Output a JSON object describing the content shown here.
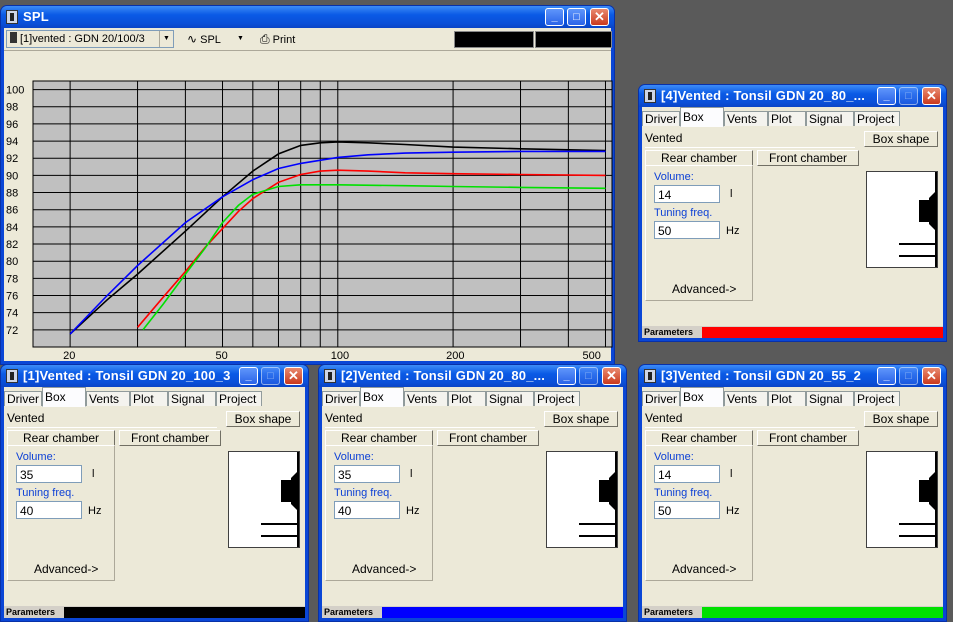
{
  "spl": {
    "title": "SPL",
    "combo_label": "[1]vented : GDN 20/100/3",
    "mode_label": "SPL",
    "print_label": "Print",
    "icons": {
      "window": "speaker-icon",
      "wave": "sine-wave-icon",
      "print": "printer-icon"
    },
    "y_ticks": [
      "100",
      "98",
      "96",
      "94",
      "92",
      "90",
      "88",
      "86",
      "84",
      "82",
      "80",
      "78",
      "76",
      "74",
      "72"
    ],
    "x_ticks": [
      "20",
      "50",
      "100",
      "200",
      "500"
    ]
  },
  "chart_data": {
    "type": "line",
    "xscale": "log",
    "xlim": [
      16,
      520
    ],
    "ylim": [
      70,
      101
    ],
    "grid": true,
    "x_ticks": [
      20,
      50,
      100,
      200,
      500
    ],
    "y_ticks": [
      72,
      74,
      76,
      78,
      80,
      82,
      84,
      86,
      88,
      90,
      92,
      94,
      96,
      98,
      100
    ],
    "series": [
      {
        "color": "#000000",
        "x": [
          20,
          25,
          30,
          40,
          50,
          60,
          70,
          80,
          90,
          100,
          120,
          150,
          200,
          300,
          500
        ],
        "y": [
          71.5,
          75.5,
          78.5,
          83.5,
          87.5,
          90.5,
          92.5,
          93.5,
          93.8,
          93.9,
          93.8,
          93.6,
          93.3,
          93.1,
          92.9
        ]
      },
      {
        "color": "#0000ff",
        "x": [
          20,
          25,
          30,
          40,
          50,
          60,
          70,
          80,
          100,
          120,
          150,
          200,
          300,
          500
        ],
        "y": [
          71.5,
          76,
          79.5,
          84.5,
          87.5,
          89.5,
          90.8,
          91.4,
          92.1,
          92.4,
          92.6,
          92.7,
          92.8,
          92.8
        ]
      },
      {
        "color": "#ff0000",
        "x": [
          30,
          35,
          40,
          45,
          50,
          55,
          60,
          70,
          80,
          90,
          100,
          120,
          150,
          200,
          300,
          500
        ],
        "y": [
          72.3,
          75.8,
          78.8,
          81.6,
          83.8,
          85.8,
          87.3,
          89.2,
          90.1,
          90.5,
          90.6,
          90.5,
          90.3,
          90.2,
          90.1,
          90.0
        ]
      },
      {
        "color": "#00e000",
        "x": [
          31,
          35,
          40,
          45,
          50,
          55,
          60,
          70,
          80,
          100,
          150,
          200,
          300,
          500
        ],
        "y": [
          72,
          75,
          78.5,
          81.5,
          84.5,
          86.5,
          87.8,
          88.7,
          88.9,
          88.9,
          88.8,
          88.7,
          88.6,
          88.5
        ]
      }
    ]
  },
  "windows": [
    {
      "title": "[4]Vented : Tonsil GDN 20_80_...",
      "tabs": [
        "Driver",
        "Box",
        "Vents",
        "Plot",
        "Signal",
        "Project"
      ],
      "active_tab": "Box",
      "type_label": "Vented",
      "box_shape_label": "Box shape",
      "rear_label": "Rear chamber",
      "front_label": "Front chamber",
      "volume_label": "Volume:",
      "volume": "14",
      "volume_unit": "l",
      "tuning_label": "Tuning freq.",
      "tuning": "50",
      "tuning_unit": "Hz",
      "advanced_label": "Advanced->",
      "status_label": "Parameters",
      "color": "#ff0000"
    },
    {
      "title": "[1]Vented : Tonsil GDN 20_100_3",
      "tabs": [
        "Driver",
        "Box",
        "Vents",
        "Plot",
        "Signal",
        "Project"
      ],
      "active_tab": "Box",
      "type_label": "Vented",
      "box_shape_label": "Box shape",
      "rear_label": "Rear chamber",
      "front_label": "Front chamber",
      "volume_label": "Volume:",
      "volume": "35",
      "volume_unit": "l",
      "tuning_label": "Tuning freq.",
      "tuning": "40",
      "tuning_unit": "Hz",
      "advanced_label": "Advanced->",
      "status_label": "Parameters",
      "color": "#000000"
    },
    {
      "title": "[2]Vented : Tonsil GDN 20_80_...",
      "tabs": [
        "Driver",
        "Box",
        "Vents",
        "Plot",
        "Signal",
        "Project"
      ],
      "active_tab": "Box",
      "type_label": "Vented",
      "box_shape_label": "Box shape",
      "rear_label": "Rear chamber",
      "front_label": "Front chamber",
      "volume_label": "Volume:",
      "volume": "35",
      "volume_unit": "l",
      "tuning_label": "Tuning freq.",
      "tuning": "40",
      "tuning_unit": "Hz",
      "advanced_label": "Advanced->",
      "status_label": "Parameters",
      "color": "#0000ff"
    },
    {
      "title": "[3]Vented : Tonsil GDN 20_55_2",
      "tabs": [
        "Driver",
        "Box",
        "Vents",
        "Plot",
        "Signal",
        "Project"
      ],
      "active_tab": "Box",
      "type_label": "Vented",
      "box_shape_label": "Box shape",
      "rear_label": "Rear chamber",
      "front_label": "Front chamber",
      "volume_label": "Volume:",
      "volume": "14",
      "volume_unit": "l",
      "tuning_label": "Tuning freq.",
      "tuning": "50",
      "tuning_unit": "Hz",
      "advanced_label": "Advanced->",
      "status_label": "Parameters",
      "color": "#00e000"
    }
  ]
}
